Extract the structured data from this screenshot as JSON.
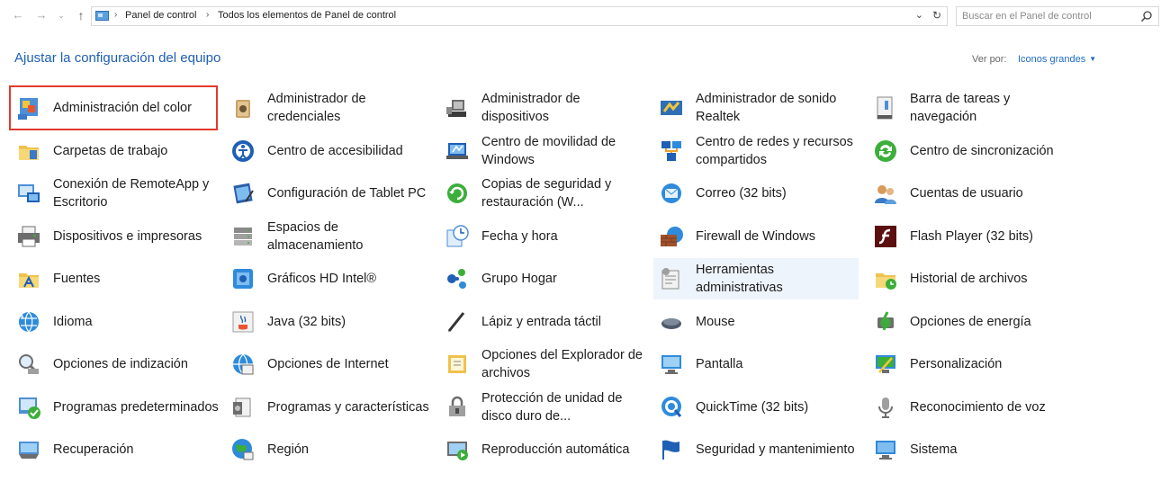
{
  "nav": {
    "back": "←",
    "forward": "→",
    "recent": "⌄",
    "up": "↑"
  },
  "address": {
    "crumbs": [
      "Panel de control",
      "Todos los elementos de Panel de control"
    ],
    "chevron": "⌄",
    "refresh": "↻"
  },
  "search": {
    "placeholder": "Buscar en el Panel de control",
    "value": ""
  },
  "header": {
    "title": "Ajustar la configuración del equipo",
    "view_by_label": "Ver por:",
    "view_by_value": "Iconos grandes"
  },
  "colors": {
    "accent": "#1e5fb3",
    "selection_outline": "#e23a2c",
    "hover": "#eef4fb"
  },
  "items": [
    {
      "label": "Administración del color",
      "icon": "color-management-icon"
    },
    {
      "label": "Administrador de credenciales",
      "icon": "credentials-icon"
    },
    {
      "label": "Administrador de dispositivos",
      "icon": "device-manager-icon"
    },
    {
      "label": "Administrador de sonido Realtek",
      "icon": "realtek-audio-icon"
    },
    {
      "label": "Barra de tareas y navegación",
      "icon": "taskbar-icon"
    },
    {
      "label": "Carpetas de trabajo",
      "icon": "work-folders-icon"
    },
    {
      "label": "Centro de accesibilidad",
      "icon": "accessibility-icon"
    },
    {
      "label": "Centro de movilidad de Windows",
      "icon": "mobility-center-icon"
    },
    {
      "label": "Centro de redes y recursos compartidos",
      "icon": "network-center-icon"
    },
    {
      "label": "Centro de sincronización",
      "icon": "sync-center-icon"
    },
    {
      "label": "Conexión de RemoteApp y Escritorio",
      "icon": "remoteapp-icon"
    },
    {
      "label": "Configuración de Tablet PC",
      "icon": "tablet-pc-icon"
    },
    {
      "label": "Copias de seguridad y restauración (W...",
      "icon": "backup-icon"
    },
    {
      "label": "Correo (32 bits)",
      "icon": "mail-icon"
    },
    {
      "label": "Cuentas de usuario",
      "icon": "user-accounts-icon"
    },
    {
      "label": "Dispositivos e impresoras",
      "icon": "printer-icon"
    },
    {
      "label": "Espacios de almacenamiento",
      "icon": "storage-spaces-icon"
    },
    {
      "label": "Fecha y hora",
      "icon": "clock-icon"
    },
    {
      "label": "Firewall de Windows",
      "icon": "firewall-icon"
    },
    {
      "label": "Flash Player (32 bits)",
      "icon": "flash-icon"
    },
    {
      "label": "Fuentes",
      "icon": "fonts-icon"
    },
    {
      "label": "Gráficos HD Intel®",
      "icon": "intel-graphics-icon"
    },
    {
      "label": "Grupo Hogar",
      "icon": "homegroup-icon"
    },
    {
      "label": "Herramientas administrativas",
      "icon": "admin-tools-icon"
    },
    {
      "label": "Historial de archivos",
      "icon": "file-history-icon"
    },
    {
      "label": "Idioma",
      "icon": "language-icon"
    },
    {
      "label": "Java (32 bits)",
      "icon": "java-icon"
    },
    {
      "label": "Lápiz y entrada táctil",
      "icon": "pen-icon"
    },
    {
      "label": "Mouse",
      "icon": "mouse-icon"
    },
    {
      "label": "Opciones de energía",
      "icon": "power-icon"
    },
    {
      "label": "Opciones de indización",
      "icon": "indexing-icon"
    },
    {
      "label": "Opciones de Internet",
      "icon": "internet-options-icon"
    },
    {
      "label": "Opciones del Explorador de archivos",
      "icon": "explorer-options-icon"
    },
    {
      "label": "Pantalla",
      "icon": "display-icon"
    },
    {
      "label": "Personalización",
      "icon": "personalization-icon"
    },
    {
      "label": "Programas predeterminados",
      "icon": "default-programs-icon"
    },
    {
      "label": "Programas y características",
      "icon": "programs-features-icon"
    },
    {
      "label": "Protección de unidad de disco duro de...",
      "icon": "bitlocker-icon"
    },
    {
      "label": "QuickTime (32 bits)",
      "icon": "quicktime-icon"
    },
    {
      "label": "Reconocimiento de voz",
      "icon": "microphone-icon"
    },
    {
      "label": "Recuperación",
      "icon": "recovery-icon"
    },
    {
      "label": "Región",
      "icon": "region-icon"
    },
    {
      "label": "Reproducción automática",
      "icon": "autoplay-icon"
    },
    {
      "label": "Seguridad y mantenimiento",
      "icon": "security-flag-icon"
    },
    {
      "label": "Sistema",
      "icon": "system-icon"
    }
  ]
}
